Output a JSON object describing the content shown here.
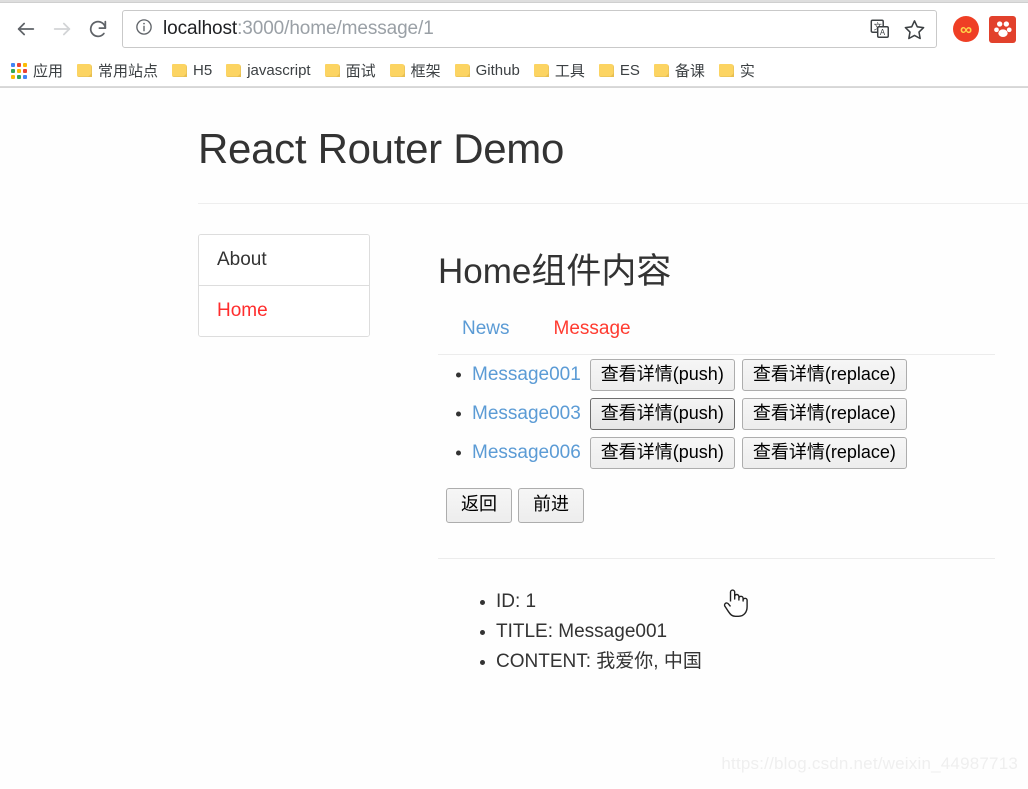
{
  "browser": {
    "back_label": "Back",
    "forward_label": "Forward",
    "reload_label": "Reload",
    "url_host": "localhost",
    "url_path": ":3000/home/message/1",
    "site_info_label": "Site information",
    "translate_label": "Translate this page",
    "bookmark_star_label": "Bookmark this tab",
    "extension_1_label": "Infinity New Tab",
    "extension_2_label": "Extension",
    "bookmarks": [
      {
        "label": "应用",
        "icon": "apps-grid-icon"
      },
      {
        "label": "常用站点",
        "icon": "folder-icon"
      },
      {
        "label": "H5",
        "icon": "folder-icon"
      },
      {
        "label": "javascript",
        "icon": "folder-icon"
      },
      {
        "label": "面试",
        "icon": "folder-icon"
      },
      {
        "label": "框架",
        "icon": "folder-icon"
      },
      {
        "label": "Github",
        "icon": "folder-icon"
      },
      {
        "label": "工具",
        "icon": "folder-icon"
      },
      {
        "label": "ES",
        "icon": "folder-icon"
      },
      {
        "label": "备课",
        "icon": "folder-icon"
      },
      {
        "label": "实",
        "icon": "folder-icon"
      }
    ]
  },
  "page": {
    "title": "React Router Demo",
    "sidebar": [
      {
        "label": "About",
        "active": false
      },
      {
        "label": "Home",
        "active": true
      }
    ],
    "content": {
      "heading": "Home组件内容",
      "tabs": [
        {
          "label": "News",
          "active": false
        },
        {
          "label": "Message",
          "active": true
        }
      ],
      "messages": [
        {
          "title": "Message001",
          "push_label": "查看详情(push)",
          "replace_label": "查看详情(replace)",
          "hovered": false
        },
        {
          "title": "Message003",
          "push_label": "查看详情(push)",
          "replace_label": "查看详情(replace)",
          "hovered": true
        },
        {
          "title": "Message006",
          "push_label": "查看详情(push)",
          "replace_label": "查看详情(replace)",
          "hovered": false
        }
      ],
      "history_actions": [
        {
          "label": "返回"
        },
        {
          "label": "前进"
        }
      ],
      "detail": [
        "ID: 1",
        "TITLE: Message001",
        "CONTENT: 我爱你, 中国"
      ]
    },
    "watermark": "https://blog.csdn.net/weixin_44987713"
  },
  "colors": {
    "link_blue": "#5b9bd5",
    "active_red": "#ff3b30",
    "text_dark": "#333333",
    "folder_yellow": "#fcd462"
  }
}
